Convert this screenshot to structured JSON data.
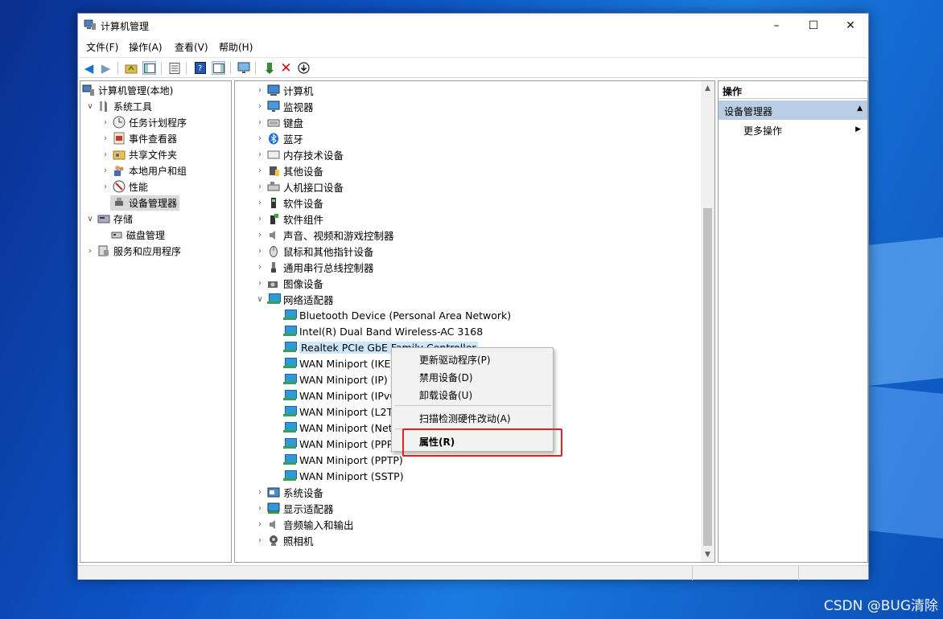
{
  "window": {
    "title": "计算机管理",
    "minimize": "–",
    "maximize": "☐",
    "close": "✕"
  },
  "menu": [
    "文件(F)",
    "操作(A)",
    "查看(V)",
    "帮助(H)"
  ],
  "left_tree": {
    "root": "计算机管理(本地)",
    "system_tools": "系统工具",
    "task_scheduler": "任务计划程序",
    "event_viewer": "事件查看器",
    "shared_folders": "共享文件夹",
    "local_users": "本地用户和组",
    "performance": "性能",
    "device_manager": "设备管理器",
    "storage": "存储",
    "disk_management": "磁盘管理",
    "services_apps": "服务和应用程序"
  },
  "devices": {
    "computer": "计算机",
    "monitors": "监视器",
    "keyboards": "键盘",
    "bluetooth": "蓝牙",
    "memory": "内存技术设备",
    "other": "其他设备",
    "hid": "人机接口设备",
    "software_devices": "软件设备",
    "software_components": "软件组件",
    "sound": "声音、视频和游戏控制器",
    "mice": "鼠标和其他指针设备",
    "usb": "通用串行总线控制器",
    "imaging": "图像设备",
    "network": "网络适配器",
    "system": "系统设备",
    "display": "显示适配器",
    "audio_io": "音频输入和输出",
    "cameras": "照相机"
  },
  "network_adapters": [
    "Bluetooth Device (Personal Area Network)",
    "Intel(R) Dual Band Wireless-AC 3168",
    "Realtek PCIe GbE Family Controller",
    "WAN Miniport (IKEv2)",
    "WAN Miniport (IP)",
    "WAN Miniport (IPv6)",
    "WAN Miniport (L2TP)",
    "WAN Miniport (Network Monitor)",
    "WAN Miniport (PPPOE)",
    "WAN Miniport (PPTP)",
    "WAN Miniport (SSTP)"
  ],
  "context_menu": {
    "update_driver": "更新驱动程序(P)",
    "disable": "禁用设备(D)",
    "uninstall": "卸载设备(U)",
    "scan": "扫描检测硬件改动(A)",
    "properties": "属性(R)"
  },
  "actions_pane": {
    "header": "操作",
    "group": "设备管理器",
    "more": "更多操作"
  },
  "watermark": "CSDN @BUG清除"
}
